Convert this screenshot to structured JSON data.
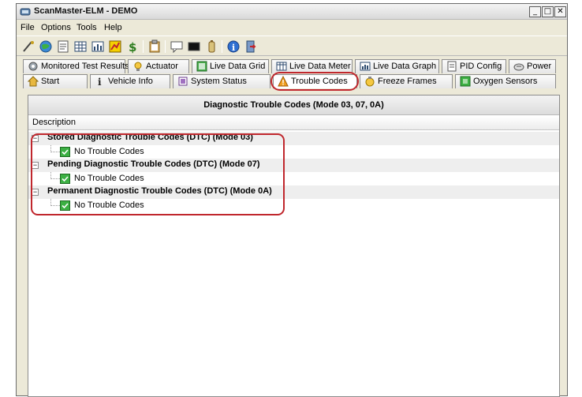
{
  "window": {
    "title": "ScanMaster-ELM - DEMO",
    "controls": {
      "minimize": "_",
      "maximize": "□",
      "close": "✕"
    }
  },
  "menu": [
    "File",
    "Options",
    "Tools",
    "Help"
  ],
  "toolbar": {
    "buttons": [
      "connect-icon",
      "globe-icon",
      "report-icon",
      "grid-icon",
      "meter-icon",
      "chart-icon",
      "dollar-icon",
      "clipboard-icon",
      "chat-icon",
      "terminal-icon",
      "battery-icon",
      "info-icon",
      "exit-icon"
    ]
  },
  "tabs": {
    "row1": [
      {
        "label": "Monitored Test Results",
        "icon": "gear-icon"
      },
      {
        "label": "Actuator",
        "icon": "bulb-icon"
      },
      {
        "label": "Live Data Grid",
        "icon": "grid-icon"
      },
      {
        "label": "Live Data Meter",
        "icon": "meter-icon"
      },
      {
        "label": "Live Data Graph",
        "icon": "graph-icon"
      },
      {
        "label": "PID Config",
        "icon": "config-icon"
      },
      {
        "label": "Power",
        "icon": "power-icon"
      }
    ],
    "row2": [
      {
        "label": "Start",
        "icon": "home-icon"
      },
      {
        "label": "Vehicle Info",
        "icon": "info-icon"
      },
      {
        "label": "System Status",
        "icon": "status-icon"
      },
      {
        "label": "Trouble Codes",
        "icon": "warning-icon",
        "active": true
      },
      {
        "label": "Freeze Frames",
        "icon": "freeze-icon"
      },
      {
        "label": "Oxygen Sensors",
        "icon": "sensor-icon"
      }
    ]
  },
  "panel": {
    "header": "Diagnostic Trouble Codes (Mode 03, 07, 0A)",
    "column": "Description",
    "groups": [
      {
        "label": "Stored Diagnostic Trouble Codes (DTC) (Mode 03)",
        "expander": "−",
        "child": "No Trouble Codes"
      },
      {
        "label": "Pending Diagnostic Trouble Codes (DTC) (Mode 07)",
        "expander": "−",
        "child": "No Trouble Codes"
      },
      {
        "label": "Permanent Diagnostic Trouble Codes (DTC) (Mode 0A)",
        "expander": "−",
        "child": "No Trouble Codes"
      }
    ]
  },
  "colors": {
    "highlight": "#c0272d",
    "ok_green": "#3cb043",
    "warning": "#f0a020"
  }
}
